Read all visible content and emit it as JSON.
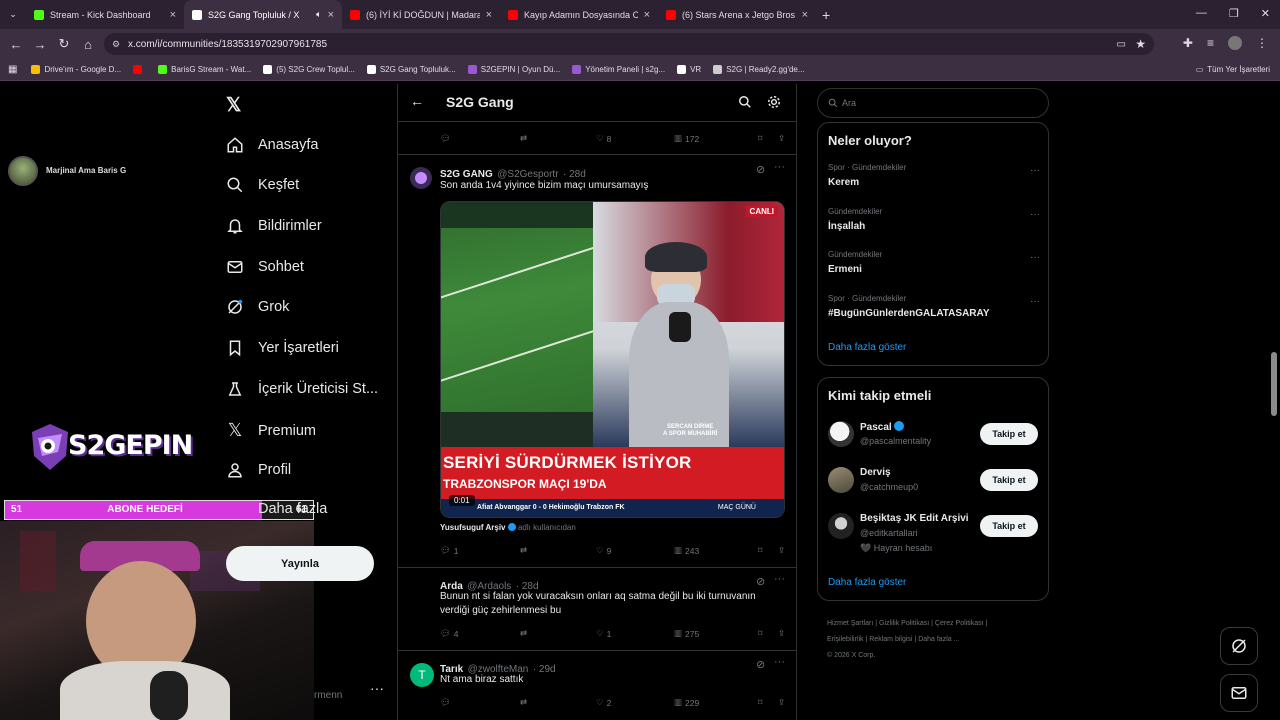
{
  "browser": {
    "tabs": [
      {
        "title": "Stream - Kick Dashboard",
        "color": "#53fc18"
      },
      {
        "title": "S2G Gang Topluluk / X",
        "color": "#ffffff",
        "active": true
      },
      {
        "title": "(6) İYİ Kİ DOĞDUN | Madara Oi",
        "color": "#ff0000"
      },
      {
        "title": "Kayıp Adamın Dosyasında Orta",
        "color": "#ff0000"
      },
      {
        "title": "(6) Stars Arena x Jetgo Bros Esp",
        "color": "#ff0000"
      }
    ],
    "new_tab": "+",
    "url": "x.com/i/communities/1835319702907961785",
    "bookmarks": [
      {
        "label": "Drive'ım - Google D...",
        "color": "#fbbc04"
      },
      {
        "label": "",
        "color": "#ff0000"
      },
      {
        "label": "BarisG Stream - Wat...",
        "color": "#53fc18"
      },
      {
        "label": "(5) S2G Crew Toplul...",
        "color": "#ffffff"
      },
      {
        "label": "S2G Gang Topluluk...",
        "color": "#ffffff"
      },
      {
        "label": "S2GEPIN | Oyun Dü...",
        "color": "#9b59d0"
      },
      {
        "label": "Yönetim Paneli | s2g...",
        "color": "#9b59d0"
      },
      {
        "label": "VR",
        "color": "#ffffff"
      },
      {
        "label": "S2G | Ready2.gg'de...",
        "color": "#cccccc"
      }
    ],
    "all_bookmarks": "Tüm Yer İşaretleri"
  },
  "nav": {
    "items": [
      "Anasayfa",
      "Keşfet",
      "Bildirimler",
      "Sohbet",
      "Grok",
      "Yer İşaretleri",
      "İçerik Üreticisi St...",
      "Premium",
      "Profil",
      "Daha fazla"
    ],
    "post_button": "Yayınla",
    "account_fragment": "rmenn"
  },
  "overlay": {
    "streamer_name": "Marjinal Ama Baris G",
    "logo_text": "S2GEPIN",
    "sub_goal_label": "ABONE HEDEFİ",
    "sub_goal_current": "51",
    "sub_goal_target": "61",
    "sub_goal_progress": 0.836
  },
  "community": {
    "title": "S2G Gang"
  },
  "tweets": [
    {
      "name": "",
      "stats": {
        "reply": "",
        "retweet": "",
        "like": "8",
        "views": "172"
      }
    },
    {
      "name": "S2G GANG",
      "handle": "@S2Gesportr",
      "time": "· 28d",
      "text": "Son anda 1v4 yiyince bizim maçı umursamayış",
      "video": {
        "live_badge": "CANLI",
        "caption_small": "SERCAN DİRME\nA SPOR MUHABİRİ",
        "headline": "SERİYİ SÜRDÜRMEK İSTİYOR",
        "subline": "TRABZONSPOR MAÇI 19'DA",
        "ticker": "Afiat Abvanggar 0 - 0 Hekimoğlu Trabzon FK",
        "ticker_right": "MAÇ GÜNÜ",
        "timestamp": "0:01"
      },
      "from_user": "Yusufsuguf Arşiv",
      "from_suffix": "adlı kullanıcıdan",
      "stats": {
        "reply": "1",
        "retweet": "",
        "like": "9",
        "views": "243"
      }
    },
    {
      "name": "Arda",
      "handle": "@Ardaols",
      "time": "· 28d",
      "text": "Bunun  nt si falan yok vuracaksın onları aq satma değil bu iki turnuvanın verdiği güç zehirlenmesi bu",
      "stats": {
        "reply": "4",
        "retweet": "",
        "like": "1",
        "views": "275"
      }
    },
    {
      "name": "Tarık",
      "handle": "@zwolfteMan",
      "time": "· 29d",
      "avatar_letter": "T",
      "avatar_color": "#00ba7c",
      "text": "Nt ama biraz sattık",
      "stats": {
        "reply": "",
        "retweet": "",
        "like": "2",
        "views": "229"
      }
    }
  ],
  "right": {
    "search_placeholder": "Ara",
    "trends_title": "Neler oluyor?",
    "trends": [
      {
        "category": "Spor · Gündemdekiler",
        "name": "Kerem"
      },
      {
        "category": "Gündemdekiler",
        "name": "İnşallah"
      },
      {
        "category": "Gündemdekiler",
        "name": "Ermeni"
      },
      {
        "category": "Spor · Gündemdekiler",
        "name": "#BugünGünlerdenGALATASARAY"
      }
    ],
    "show_more": "Daha fazla göster",
    "who_title": "Kimi takip etmeli",
    "who": [
      {
        "name": "Pascal",
        "handle": "@pascalmentality",
        "verified": true,
        "extra": ""
      },
      {
        "name": "Derviş",
        "handle": "@catchmeup0",
        "verified": false,
        "extra": ""
      },
      {
        "name": "Beşiktaş JK Edit Arşivi",
        "handle": "@editkartallari",
        "verified": false,
        "extra": "🖤 Hayran hesabı"
      }
    ],
    "follow_label": "Takip et",
    "show_more2": "Daha fazla göster",
    "footer": [
      "Hizmet Şartları",
      "Gizlilik Politikası",
      "Çerez Politikası",
      "Erişilebilirlik",
      "Reklam bilgisi",
      "Daha fazla ...",
      "© 2026 X Corp."
    ]
  }
}
